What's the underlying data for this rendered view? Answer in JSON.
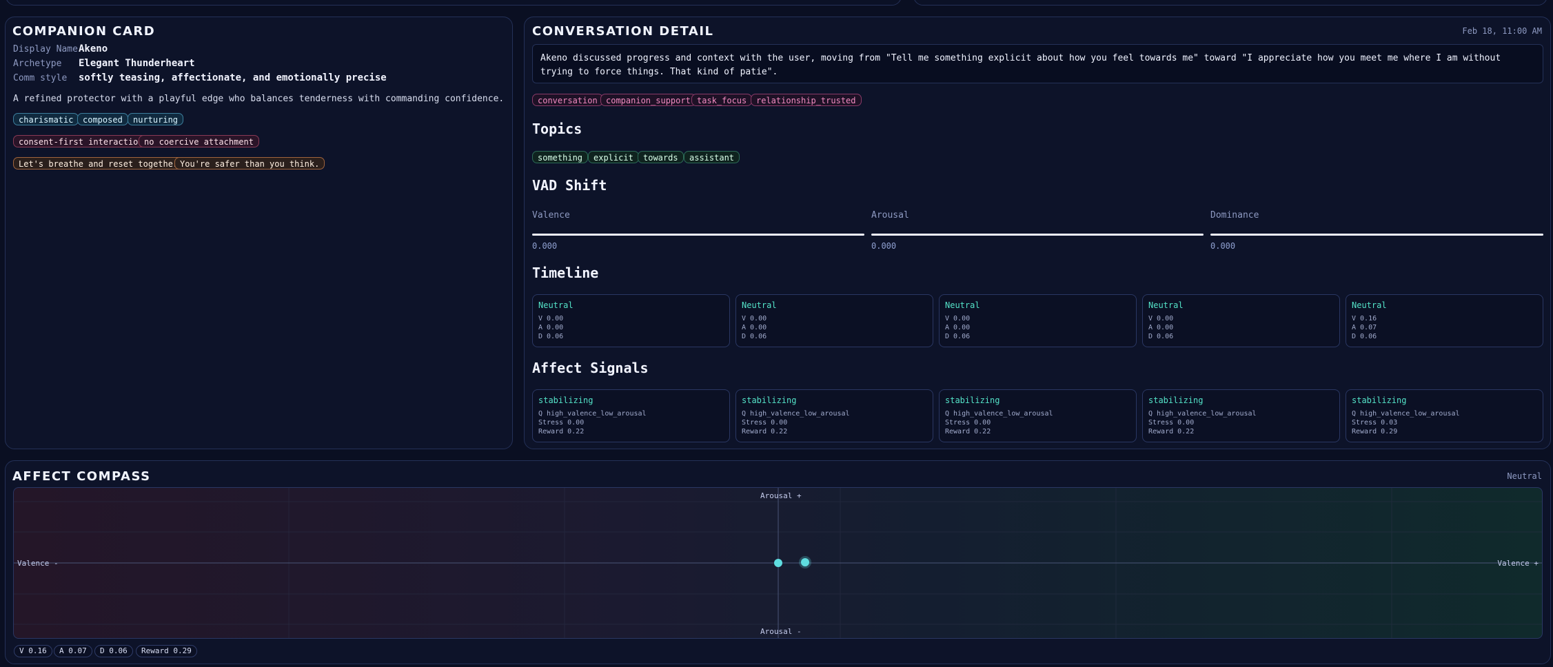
{
  "companion": {
    "title": "COMPANION CARD",
    "display_name_label": "Display Name",
    "display_name": "Akeno",
    "archetype_label": "Archetype",
    "archetype": "Elegant Thunderheart",
    "comm_label": "Comm style",
    "comm": "softly teasing, affectionate, and emotionally precise",
    "description": "A refined protector with a playful edge who balances tenderness with commanding confidence.",
    "traits": [
      "charismatic",
      "composed",
      "nurturing"
    ],
    "boundaries": [
      "consent-first interaction",
      "no coercive attachment"
    ],
    "phrases": [
      "Let's breathe and reset together.",
      "You're safer than you think."
    ]
  },
  "conversation": {
    "title": "CONVERSATION DETAIL",
    "timestamp": "Feb 18, 11:00 AM",
    "summary_line1": "Akeno discussed progress and context with the user, moving from \"Tell me something explicit about how you feel towards me\" toward \"I appreciate how you meet me where I am without",
    "summary_line2": "trying to force things. That kind of patie\".",
    "tags": [
      "conversation",
      "companion_support",
      "task_focus",
      "relationship_trusted"
    ],
    "topics_heading": "Topics",
    "topics": [
      "something",
      "explicit",
      "towards",
      "assistant"
    ],
    "vad_heading": "VAD Shift",
    "vad": [
      {
        "label": "Valence",
        "value": "0.000"
      },
      {
        "label": "Arousal",
        "value": "0.000"
      },
      {
        "label": "Dominance",
        "value": "0.000"
      }
    ],
    "timeline_heading": "Timeline",
    "timeline": [
      {
        "state": "Neutral",
        "v": "V 0.00",
        "a": "A 0.00",
        "d": "D 0.06"
      },
      {
        "state": "Neutral",
        "v": "V 0.00",
        "a": "A 0.00",
        "d": "D 0.06"
      },
      {
        "state": "Neutral",
        "v": "V 0.00",
        "a": "A 0.00",
        "d": "D 0.06"
      },
      {
        "state": "Neutral",
        "v": "V 0.00",
        "a": "A 0.00",
        "d": "D 0.06"
      },
      {
        "state": "Neutral",
        "v": "V 0.16",
        "a": "A 0.07",
        "d": "D 0.06"
      }
    ],
    "signals_heading": "Affect Signals",
    "signals": [
      {
        "type": "stabilizing",
        "q": "Q high_valence_low_arousal",
        "stress": "Stress 0.00",
        "reward": "Reward 0.22"
      },
      {
        "type": "stabilizing",
        "q": "Q high_valence_low_arousal",
        "stress": "Stress 0.00",
        "reward": "Reward 0.22"
      },
      {
        "type": "stabilizing",
        "q": "Q high_valence_low_arousal",
        "stress": "Stress 0.00",
        "reward": "Reward 0.22"
      },
      {
        "type": "stabilizing",
        "q": "Q high_valence_low_arousal",
        "stress": "Stress 0.00",
        "reward": "Reward 0.22"
      },
      {
        "type": "stabilizing",
        "q": "Q high_valence_low_arousal",
        "stress": "Stress 0.03",
        "reward": "Reward 0.29"
      }
    ]
  },
  "compass": {
    "title": "AFFECT COMPASS",
    "state": "Neutral",
    "arousal_plus": "Arousal +",
    "arousal_minus": "Arousal -",
    "valence_minus": "Valence -",
    "valence_plus": "Valence +",
    "point_valence": 0.16,
    "point_arousal": 0.07,
    "chips": [
      "V 0.16",
      "A 0.07",
      "D 0.06",
      "Reward 0.29"
    ]
  },
  "colors": {
    "accent": "#54e3c8",
    "point": "#5fdde0",
    "tag_pink": "#f28bc1"
  }
}
